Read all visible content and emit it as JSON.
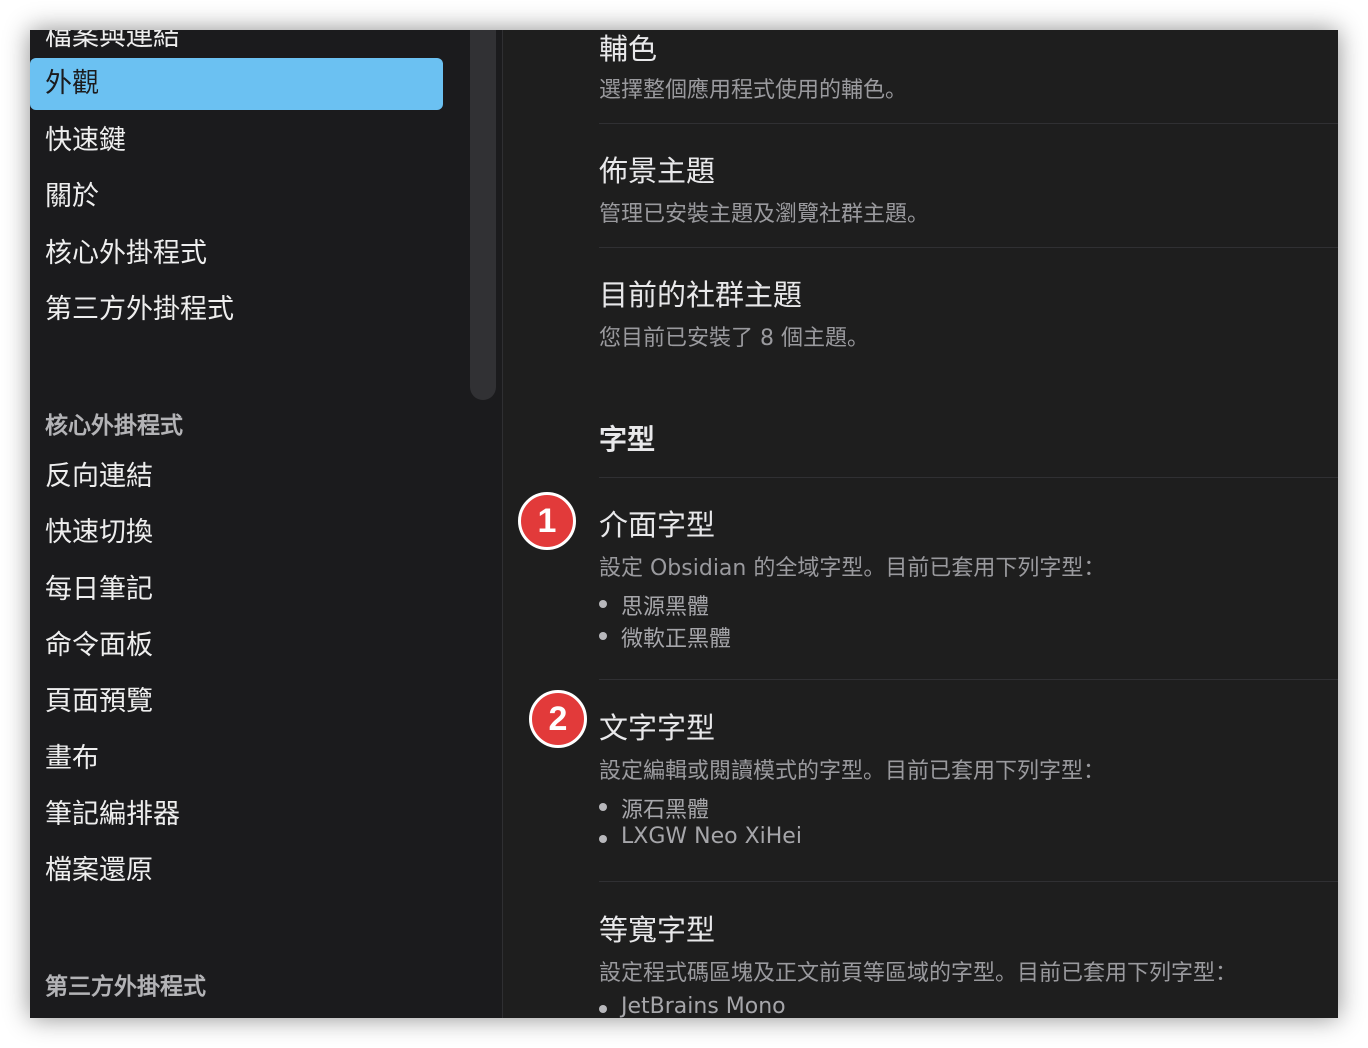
{
  "sidebar": {
    "options_items": [
      {
        "label": "檔案與連結"
      },
      {
        "label": "外觀"
      },
      {
        "label": "快速鍵"
      },
      {
        "label": "關於"
      },
      {
        "label": "核心外掛程式"
      },
      {
        "label": "第三方外掛程式"
      }
    ],
    "core_plugins_heading": "核心外掛程式",
    "core_plugins_items": [
      {
        "label": "反向連結"
      },
      {
        "label": "快速切換"
      },
      {
        "label": "每日筆記"
      },
      {
        "label": "命令面板"
      },
      {
        "label": "頁面預覽"
      },
      {
        "label": "畫布"
      },
      {
        "label": "筆記編排器"
      },
      {
        "label": "檔案還原"
      }
    ],
    "community_plugins_heading": "第三方外掛程式",
    "active_item": "外觀"
  },
  "content": {
    "accent": {
      "name": "輔色",
      "desc": "選擇整個應用程式使用的輔色。"
    },
    "themes": {
      "name": "佈景主題",
      "desc": "管理已安裝主題及瀏覽社群主題。"
    },
    "current_theme": {
      "name": "目前的社群主題",
      "desc": "您目前已安裝了 8 個主題。"
    },
    "font_section_heading": "字型",
    "interface_font": {
      "name": "介面字型",
      "desc": "設定 Obsidian 的全域字型。目前已套用下列字型：",
      "fonts": [
        "思源黑體",
        "微軟正黑體"
      ]
    },
    "text_font": {
      "name": "文字字型",
      "desc": "設定編輯或閱讀模式的字型。目前已套用下列字型：",
      "fonts": [
        "源石黑體",
        "LXGW Neo XiHei"
      ]
    },
    "monospace_font": {
      "name": "等寬字型",
      "desc": "設定程式碼區塊及正文前頁等區域的字型。目前已套用下列字型：",
      "fonts": [
        "JetBrains Mono"
      ]
    }
  },
  "callouts": [
    "1",
    "2"
  ],
  "colors": {
    "accent_highlight": "#6bc1f2",
    "callout_red": "#e23a3a",
    "sidebar_bg": "#1b1b1d",
    "content_bg": "#1e1e1e"
  }
}
